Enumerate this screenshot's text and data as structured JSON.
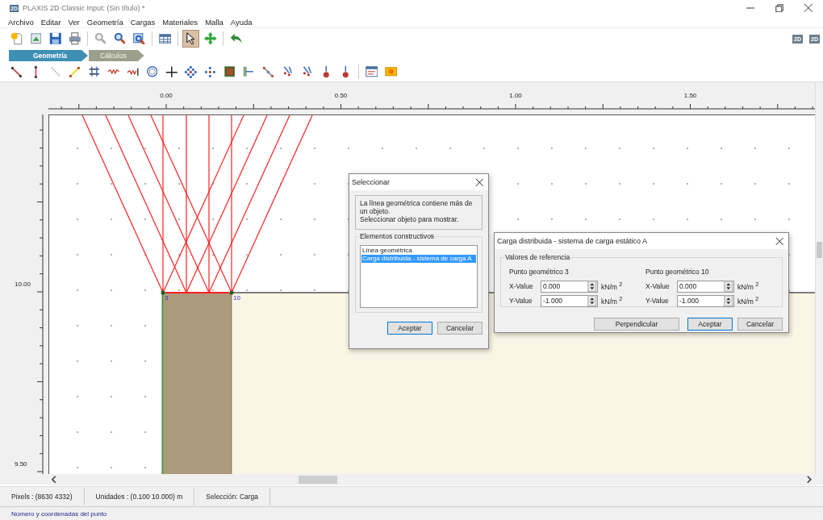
{
  "window": {
    "title": "PLAXIS 2D Classic Input: (Sin título) *",
    "app_icon": "2D"
  },
  "menu": [
    "Archivo",
    "Editar",
    "Ver",
    "Geometría",
    "Cargas",
    "Materiales",
    "Malla",
    "Ayuda"
  ],
  "main_toolbar": [
    {
      "selected": false
    },
    {
      "selected": false
    },
    {
      "selected": false
    },
    {
      "selected": false
    },
    {
      "selected": false
    },
    {
      "selected": false
    },
    {
      "selected": false
    },
    {
      "selected": false
    },
    {
      "selected": true
    },
    {
      "selected": false
    },
    {
      "selected": false
    }
  ],
  "view_buttons": [
    "2D",
    "2D"
  ],
  "tabs": [
    {
      "label": "Geometría",
      "selected": true
    },
    {
      "label": "Cálculos",
      "selected": false
    }
  ],
  "rulers": {
    "horizontal": [
      "0.00",
      "0.50",
      "1.00",
      "1.50"
    ],
    "vertical": [
      "10.00",
      "9.50"
    ]
  },
  "canvas": {
    "point_labels": [
      "3",
      "10"
    ]
  },
  "select_dialog": {
    "title": "Seleccionar",
    "message": [
      "La línea geométrica contiene más de un objeto.",
      "Seleccionar objeto para mostrar."
    ],
    "group": "Elementos constructivos",
    "items": [
      {
        "label": "Línea geométrica",
        "selected": false
      },
      {
        "label": "Carga distribuida - sistema de carga A",
        "selected": true
      }
    ],
    "buttons": [
      {
        "label": "Aceptar",
        "default": true
      },
      {
        "label": "Cancelar",
        "default": false
      }
    ]
  },
  "load_dialog": {
    "title": "Carga distribuida - sistema de carga estático A",
    "group": "Valores de referencia",
    "points": [
      {
        "heading": "Punto geométrico 3",
        "rows": [
          {
            "label": "X-Value",
            "value": "0.000",
            "unit": "kN/m $^{2}$"
          },
          {
            "label": "Y-Value",
            "value": "-1.000",
            "unit": "kN/m $^{2}$"
          }
        ]
      },
      {
        "heading": "Punto geométrico 10",
        "rows": [
          {
            "label": "X-Value",
            "value": "0.000",
            "unit": "kN/m $^{2}$"
          },
          {
            "label": "Y-Value",
            "value": "-1.000",
            "unit": "kN/m $^{2}$"
          }
        ]
      }
    ],
    "buttons": [
      {
        "label": "Perpendicular",
        "default": false
      },
      {
        "label": "Aceptar",
        "default": true
      },
      {
        "label": "Cancelar",
        "default": false
      }
    ]
  },
  "status_bar": [
    "Pixels : (8630 4332)",
    "Unidades : (0.100 10.000) m",
    "Selección: Carga"
  ],
  "hint": "Número y coordenadas del punto"
}
